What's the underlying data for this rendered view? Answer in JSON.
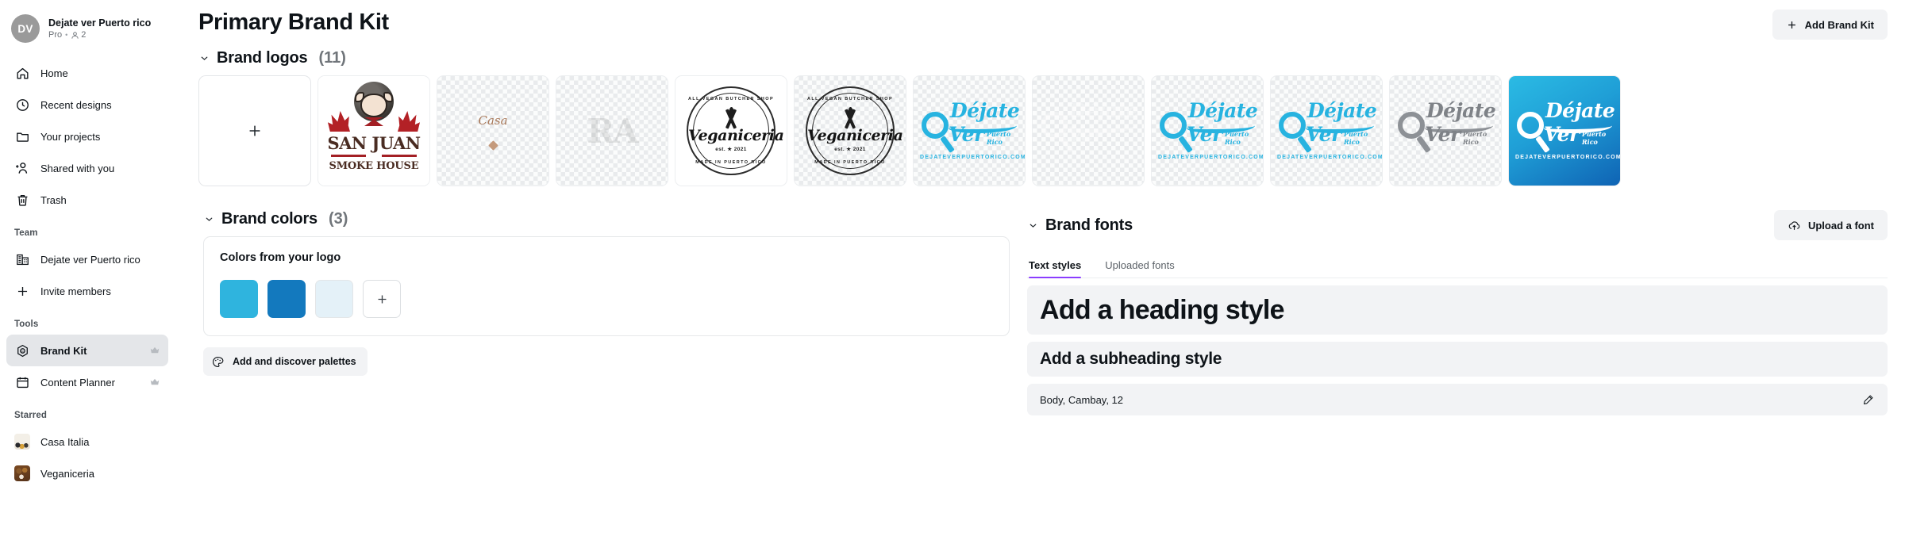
{
  "sidebar": {
    "profile": {
      "initials": "DV",
      "name": "Dejate ver Puerto rico",
      "plan": "Pro",
      "separator": "•",
      "member_count": "2"
    },
    "nav": [
      {
        "label": "Home",
        "icon": "home-icon"
      },
      {
        "label": "Recent designs",
        "icon": "clock-icon"
      },
      {
        "label": "Your projects",
        "icon": "folder-icon"
      },
      {
        "label": "Shared with you",
        "icon": "shared-users-icon"
      },
      {
        "label": "Trash",
        "icon": "trash-icon"
      }
    ],
    "team_label": "Team",
    "team": [
      {
        "label": "Dejate ver Puerto rico",
        "icon": "building-icon"
      },
      {
        "label": "Invite members",
        "icon": "plus-icon"
      }
    ],
    "tools_label": "Tools",
    "tools": [
      {
        "label": "Brand Kit",
        "icon": "brand-kit-icon",
        "badge": "crown-icon",
        "active": true
      },
      {
        "label": "Content Planner",
        "icon": "calendar-icon",
        "badge": "crown-icon",
        "active": false
      }
    ],
    "starred_label": "Starred",
    "starred": [
      {
        "label": "Casa Italia",
        "thumb": "casa-italia-thumbnail"
      },
      {
        "label": "Veganiceria",
        "thumb": "veganiceria-thumbnail"
      }
    ]
  },
  "header": {
    "title": "Primary Brand Kit",
    "add_button": "Add Brand Kit",
    "add_icon": "plus-icon"
  },
  "logos_section": {
    "title": "Brand logos",
    "count": "(11)",
    "chevron": "chevron-down-icon",
    "add_tile_icon": "plus-icon",
    "items": [
      {
        "name": "san-juan-smoke-house",
        "line1": "SAN JUAN",
        "line2": "SMOKE HOUSE"
      },
      {
        "name": "casa-italia-script",
        "script": "Casa"
      },
      {
        "name": "faded-logo-a"
      },
      {
        "name": "veganiceria-seal-white",
        "top": "ALL VEGAN BUTCHER SHOP",
        "bottom": "MADE IN PUERTO RICO",
        "brand": "Veganiceria",
        "est": "est. ★ 2021"
      },
      {
        "name": "veganiceria-seal-transparent",
        "top": "ALL VEGAN BUTCHER SHOP",
        "bottom": "MADE IN PUERTO RICO",
        "brand": "Veganiceria",
        "est": "est. ★ 2021"
      },
      {
        "name": "dejate-ver-cyan",
        "word1": "Déjate",
        "word2": "Ver",
        "tag": "Puerto Rico",
        "url": "DEJATEVERPUERTORICO.COM"
      },
      {
        "name": "dejate-ver-faded"
      },
      {
        "name": "dejate-ver-blue-1",
        "word1": "Déjate",
        "word2": "Ver",
        "tag": "Puerto Rico",
        "url": "DEJATEVERPUERTORICO.COM"
      },
      {
        "name": "dejate-ver-blue-2",
        "word1": "Déjate",
        "word2": "Ver",
        "tag": "Puerto Rico",
        "url": "DEJATEVERPUERTORICO.COM"
      },
      {
        "name": "dejate-ver-silver",
        "word1": "Déjate",
        "word2": "Ver",
        "tag": "Puerto Rico"
      },
      {
        "name": "dejate-ver-gradient",
        "word1": "Déjate",
        "word2": "Ver",
        "tag": "Puerto Rico",
        "url": "DEJATEVERPUERTORICO.COM"
      }
    ]
  },
  "colors_section": {
    "title": "Brand colors",
    "count": "(3)",
    "chevron": "chevron-down-icon",
    "panel_title": "Colors from your logo",
    "swatches": [
      "#2fb4de",
      "#1379be",
      "#e4f1f8"
    ],
    "add_swatch_icon": "plus-icon",
    "palette_button": "Add and discover palettes",
    "palette_icon": "palette-icon"
  },
  "fonts_section": {
    "title": "Brand fonts",
    "chevron": "chevron-down-icon",
    "upload_button": "Upload a font",
    "upload_icon": "cloud-upload-icon",
    "tabs": [
      {
        "label": "Text styles",
        "active": true
      },
      {
        "label": "Uploaded fonts",
        "active": false
      }
    ],
    "styles": [
      {
        "label": "Add a heading style",
        "kind": "heading"
      },
      {
        "label": "Add a subheading style",
        "kind": "subheading"
      },
      {
        "label": "Body, Cambay, 12",
        "kind": "body",
        "edit_icon": "pencil-icon"
      }
    ]
  }
}
